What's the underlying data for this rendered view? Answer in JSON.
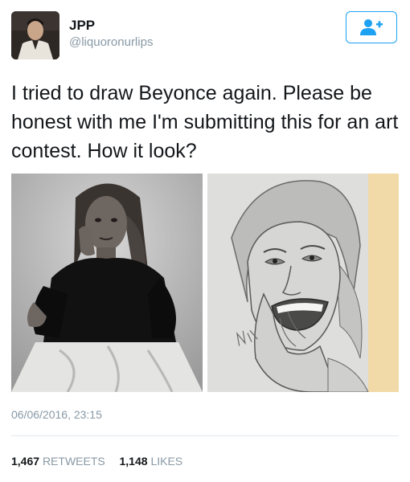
{
  "user": {
    "name": "JPP",
    "handle": "@liquoronurlips"
  },
  "tweet": {
    "text": "I tried to draw Beyonce again. Please be honest with me I'm submitting this for an art contest. How it look?",
    "timestamp": "06/06/2016, 23:15"
  },
  "stats": {
    "retweets_count": "1,467",
    "retweets_label": "RETWEETS",
    "likes_count": "1,148",
    "likes_label": "LIKES"
  },
  "colors": {
    "accent": "#1da1f2",
    "muted": "#8899a6",
    "text": "#14171a"
  },
  "icons": {
    "follow": "add-user-icon"
  }
}
